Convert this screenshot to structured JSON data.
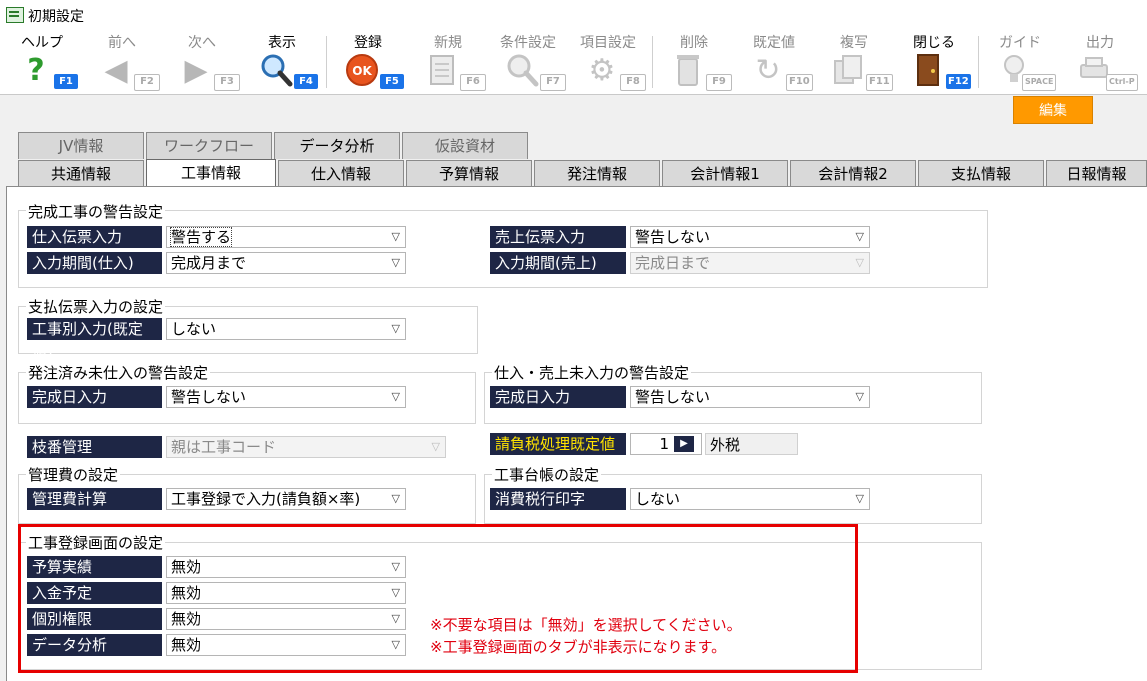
{
  "window": {
    "title": "初期設定"
  },
  "toolbar": {
    "help": {
      "label": "ヘルプ",
      "key": "F1"
    },
    "prev": {
      "label": "前へ",
      "key": "F2"
    },
    "next": {
      "label": "次へ",
      "key": "F3"
    },
    "show": {
      "label": "表示",
      "key": "F4"
    },
    "register": {
      "label": "登録",
      "key": "F5"
    },
    "new": {
      "label": "新規",
      "key": "F6"
    },
    "condition": {
      "label": "条件設定",
      "key": "F7"
    },
    "item": {
      "label": "項目設定",
      "key": "F8"
    },
    "delete": {
      "label": "削除",
      "key": "F9"
    },
    "default": {
      "label": "既定値",
      "key": "F10"
    },
    "copy": {
      "label": "複写",
      "key": "F11"
    },
    "close": {
      "label": "閉じる",
      "key": "F12"
    },
    "guide": {
      "label": "ガイド",
      "key": "SPACE"
    },
    "output": {
      "label": "出力",
      "key": "Ctrl-P"
    }
  },
  "edit_button": "編集",
  "upper_tabs": [
    "JV情報",
    "ワークフロー",
    "データ分析",
    "仮設資材"
  ],
  "lower_tabs": [
    "共通情報",
    "工事情報",
    "仕入情報",
    "予算情報",
    "発注情報",
    "会計情報1",
    "会計情報2",
    "支払情報",
    "日報情報"
  ],
  "sections": {
    "completion_warning": {
      "title": "完成工事の警告設定",
      "purchase_slip_label": "仕入伝票入力",
      "purchase_slip_value": "警告する",
      "sales_slip_label": "売上伝票入力",
      "sales_slip_value": "警告しない",
      "period_purchase_label": "入力期間(仕入)",
      "period_purchase_value": "完成月まで",
      "period_sales_label": "入力期間(売上)",
      "period_sales_value": "完成日まで"
    },
    "payment_slip": {
      "title": "支払伝票入力の設定",
      "label": "工事別入力(既定値)",
      "value": "しない"
    },
    "ordered_uninput": {
      "title": "発注済み未仕入の警告設定",
      "label": "完成日入力",
      "value": "警告しない"
    },
    "purchase_sales_uninput": {
      "title": "仕入・売上未入力の警告設定",
      "label": "完成日入力",
      "value": "警告しない"
    },
    "branch": {
      "label": "枝番管理",
      "value": "親は工事コード"
    },
    "tax": {
      "label": "請負税処理既定値",
      "code": "1",
      "value": "外税"
    },
    "mgmt_fee": {
      "title": "管理費の設定",
      "label": "管理費計算",
      "value": "工事登録で入力(請負額×率)"
    },
    "ledger": {
      "title": "工事台帳の設定",
      "label": "消費税行印字",
      "value": "しない"
    },
    "registration_screen": {
      "title": "工事登録画面の設定",
      "rows": [
        {
          "label": "予算実績",
          "value": "無効"
        },
        {
          "label": "入金予定",
          "value": "無効"
        },
        {
          "label": "個別権限",
          "value": "無効"
        },
        {
          "label": "データ分析",
          "value": "無効"
        }
      ],
      "note1": "※不要な項目は「無効」を選択してください。",
      "note2": "※工事登録画面のタブが非表示になります。"
    }
  },
  "colors": {
    "label_bg": "#1e2645",
    "accent": "#1a73e8",
    "highlight": "#e60000",
    "edit": "#ff9900"
  }
}
